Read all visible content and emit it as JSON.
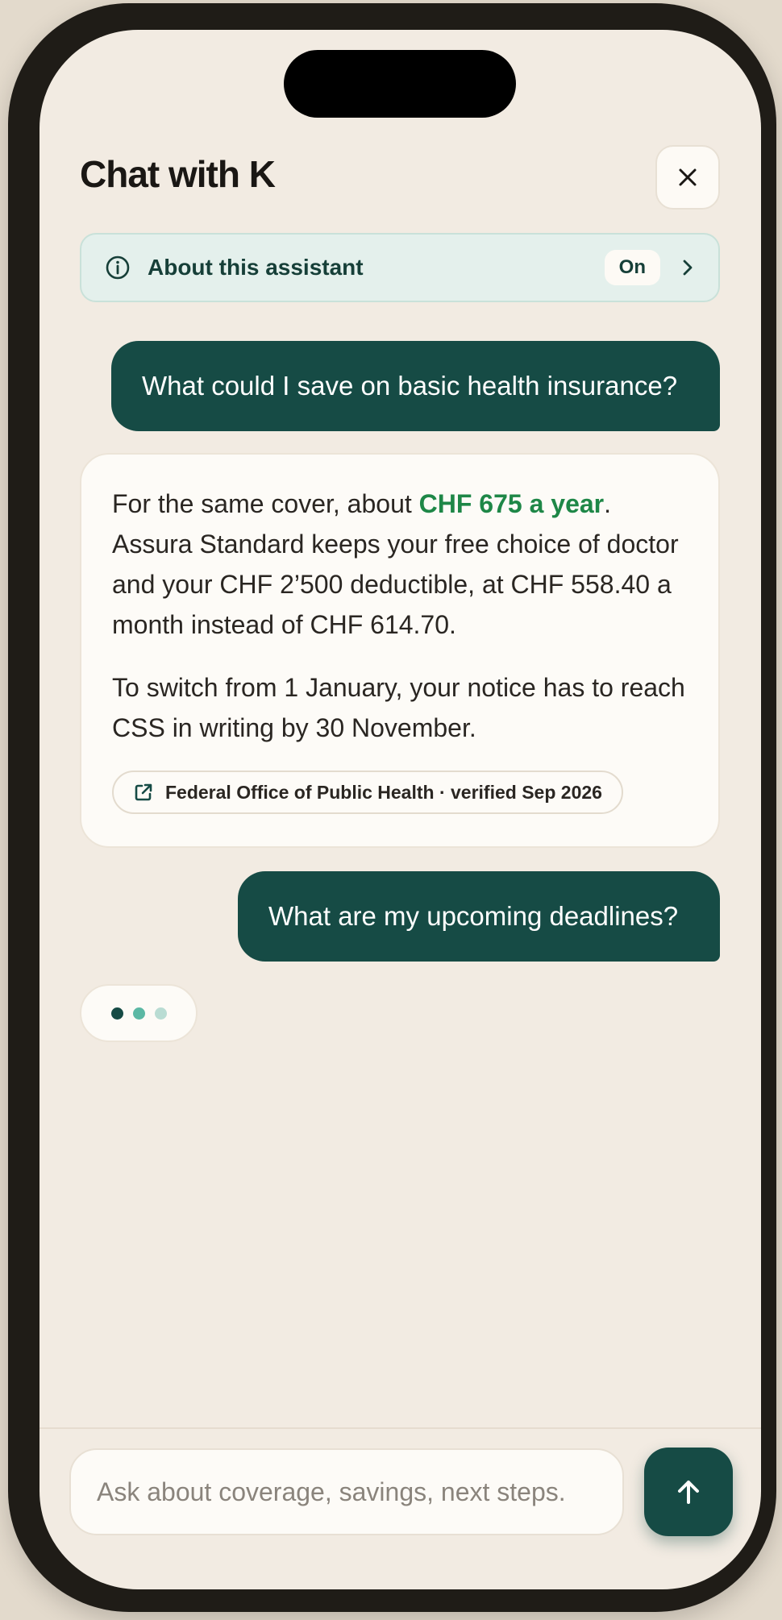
{
  "header": {
    "title": "Chat with K",
    "close_icon": "close-icon"
  },
  "about_bar": {
    "label": "About this assistant",
    "status": "On",
    "icon": "info-icon"
  },
  "messages": [
    {
      "role": "user",
      "text": "What could I save on basic health insurance?"
    },
    {
      "role": "assistant",
      "para1_prefix": "For the same cover, about ",
      "para1_highlight": "CHF 675 a year",
      "para1_suffix": ". Assura Standard keeps your free choice of doctor and your CHF 2’500 deductible, at CHF 558.40 a month instead of CHF 614.70.",
      "para2": "To switch from 1 January, your notice has to reach CSS in writing by 30 November.",
      "source": "Federal Office of Public Health · verified Sep 2026"
    },
    {
      "role": "user",
      "text": "What are my upcoming deadlines?"
    }
  ],
  "typing_indicator": {
    "dot_colors": [
      "#164b45",
      "#5bb8a4",
      "#b9dcd3"
    ]
  },
  "composer": {
    "placeholder": "Ask about coverage, savings, next steps.",
    "value": "",
    "send_icon": "arrow-up-icon"
  },
  "colors": {
    "accent": "#164b45",
    "highlight": "#1e8747",
    "background": "#f2ebe2"
  }
}
